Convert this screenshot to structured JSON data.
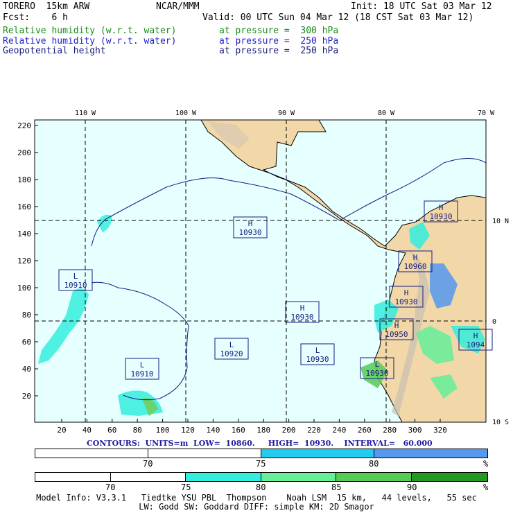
{
  "header": {
    "model": "TORERO  15km ARW",
    "center": "NCAR/MMM",
    "init": "Init: 18 UTC Sat 03 Mar 12",
    "fcst": "Fcst:    6 h",
    "valid": "Valid: 00 UTC Sun 04 Mar 12 (18 CST Sat 03 Mar 12)",
    "fields": [
      {
        "name": "Relative humidity (w.r.t. water)",
        "level": "at pressure =  300 hPa",
        "color": "#1a8a1a"
      },
      {
        "name": "Relative humidity (w.r.t. water)",
        "level": "at pressure =  250 hPa",
        "color": "#2020c8"
      },
      {
        "name": "Geopotential height",
        "level": "at pressure =  250 hPa",
        "color": "#1a1a80"
      }
    ]
  },
  "map": {
    "lon_labels": [
      "110 W",
      "100 W",
      "90 W",
      "80 W",
      "70 W"
    ],
    "lat_labels": [
      "10 N",
      "0",
      "10 S"
    ],
    "y_ticks": [
      "220",
      "200",
      "180",
      "160",
      "140",
      "120",
      "100",
      "80",
      "60",
      "40",
      "20"
    ],
    "x_ticks": [
      "20",
      "40",
      "60",
      "80",
      "100",
      "120",
      "140",
      "160",
      "180",
      "200",
      "220",
      "240",
      "260",
      "280",
      "300",
      "320"
    ],
    "centers": [
      {
        "type": "H",
        "value": "10930"
      },
      {
        "type": "H",
        "value": "10930"
      },
      {
        "type": "H",
        "value": "10960"
      },
      {
        "type": "H",
        "value": "10930"
      },
      {
        "type": "H",
        "value": "10930"
      },
      {
        "type": "H",
        "value": "10950"
      },
      {
        "type": "H",
        "value": "1094"
      },
      {
        "type": "L",
        "value": "10910"
      },
      {
        "type": "L",
        "value": "10920"
      },
      {
        "type": "L",
        "value": "10930"
      },
      {
        "type": "L",
        "value": "10910"
      },
      {
        "type": "L",
        "value": "10930"
      }
    ]
  },
  "contours": "CONTOURS:  UNITS=m  LOW=  10860.     HIGH=  10930.    INTERVAL=   60.000",
  "colorbar_250": {
    "labels": [
      "70",
      "75",
      "80",
      "%"
    ],
    "colors": [
      "#ffffff",
      "#ffffff",
      "#22ccee",
      "#5599ee"
    ]
  },
  "colorbar_300": {
    "labels": [
      "70",
      "75",
      "80",
      "85",
      "90",
      "%"
    ],
    "colors": [
      "#ffffff",
      "#ffffff",
      "#33eedd",
      "#66ee99",
      "#55cc55",
      "#229922"
    ]
  },
  "footer": {
    "line1": "Model Info: V3.3.1   Tiedtke YSU PBL  Thompson    Noah LSM  15 km,   44 levels,   55 sec",
    "line2": "LW: Godd SW: Goddard DIFF: simple KM: 2D Smagor"
  }
}
